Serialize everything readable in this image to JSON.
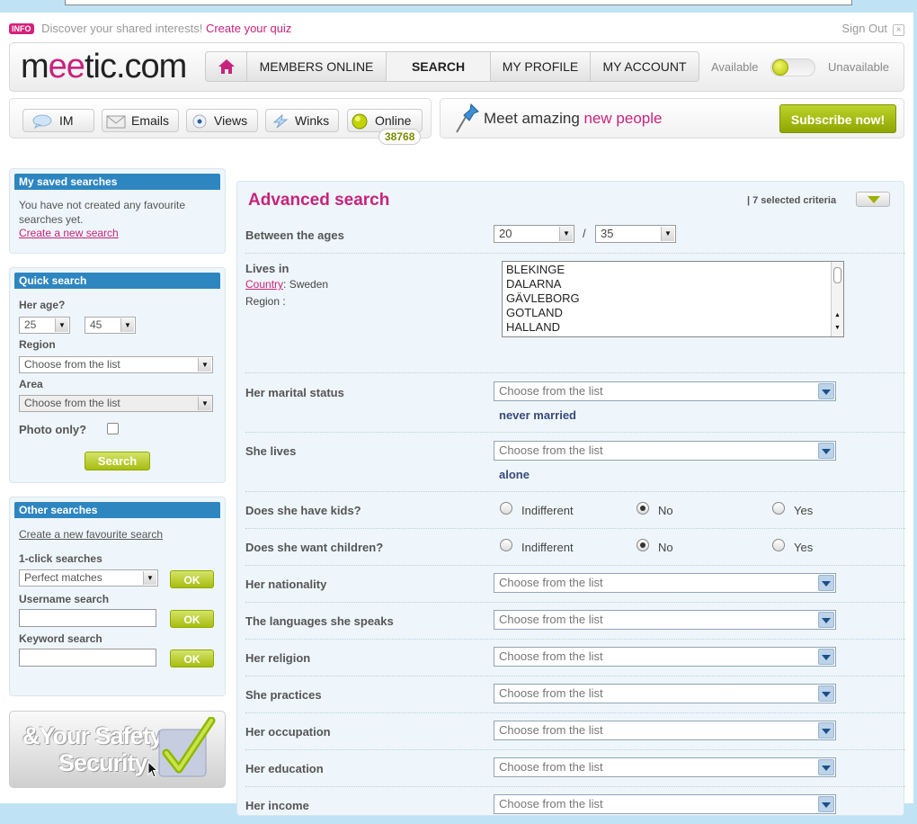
{
  "infobar": {
    "badge": "INFO",
    "text": "Discover your shared interests!",
    "link": "Create your quiz",
    "signout": "Sign Out",
    "signout_close": "×"
  },
  "header": {
    "logo_left": "m",
    "logo_ee": "ee",
    "logo_right": "tic.com",
    "nav": [
      "MEMBERS ONLINE",
      "SEARCH",
      "MY PROFILE",
      "MY ACCOUNT"
    ],
    "nav_active": "SEARCH",
    "available": "Available",
    "unavailable": "Unavailable"
  },
  "toolbar": {
    "im": "IM",
    "emails": "Emails",
    "views": "Views",
    "winks": "Winks",
    "online": "Online",
    "online_count": "38768"
  },
  "promo": {
    "text_a": "Meet amazing ",
    "text_b": "new people",
    "subscribe": "Subscribe now!"
  },
  "sidebar": {
    "saved": {
      "title": "My saved searches",
      "text": "You have not created any favourite searches yet.",
      "link": "Create a new search"
    },
    "quick": {
      "title": "Quick search",
      "age_label": "Her age?",
      "age_from": "25",
      "age_to": "45",
      "region_label": "Region",
      "region_value": "Choose from the list",
      "area_label": "Area",
      "area_value": "Choose from the list",
      "photo_label": "Photo only?",
      "search_button": "Search"
    },
    "other": {
      "title": "Other searches",
      "link": "Create a new favourite search",
      "oneclick_label": "1-click searches",
      "oneclick_value": "Perfect matches",
      "username_label": "Username search",
      "keyword_label": "Keyword search",
      "ok": "OK"
    },
    "safety": {
      "line1": "&Your Safety",
      "line2": "Security"
    }
  },
  "main": {
    "title": "Advanced search",
    "criteria": "| 7 selected criteria",
    "ages": {
      "label": "Between the ages",
      "from": "20",
      "sep": "/",
      "to": "35"
    },
    "lives": {
      "label": "Lives in",
      "country_link": "Country",
      "country_value": ": Sweden",
      "region_label": "Region :",
      "regions": [
        "BLEKINGE",
        "DALARNA",
        "GÄVLEBORG",
        "GOTLAND",
        "HALLAND"
      ]
    },
    "marital": {
      "label": "Her marital status",
      "value": "Choose from the list",
      "chosen": "never married"
    },
    "she_lives": {
      "label": "She lives",
      "value": "Choose from the list",
      "chosen": "alone"
    },
    "kids": {
      "label": "Does she have kids?",
      "options": [
        "Indifferent",
        "No",
        "Yes"
      ],
      "selected": "No"
    },
    "want_children": {
      "label": "Does she want children?",
      "options": [
        "Indifferent",
        "No",
        "Yes"
      ],
      "selected": "No"
    },
    "selects": [
      {
        "label": "Her nationality",
        "value": "Choose from the list"
      },
      {
        "label": "The languages she speaks",
        "value": "Choose from the list"
      },
      {
        "label": "Her religion",
        "value": "Choose from the list"
      },
      {
        "label": "She practices",
        "value": "Choose from the list"
      },
      {
        "label": "Her occupation",
        "value": "Choose from the list"
      },
      {
        "label": "Her education",
        "value": "Choose from the list"
      },
      {
        "label": "Her income",
        "value": "Choose from the list"
      }
    ]
  }
}
